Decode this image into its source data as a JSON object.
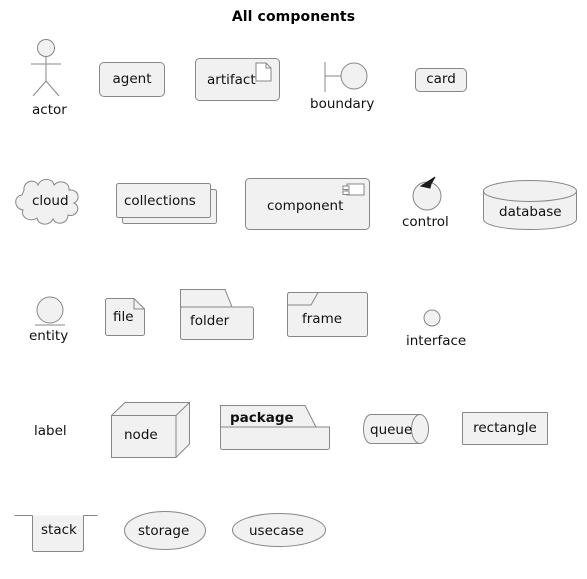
{
  "title": "All components",
  "colors": {
    "shape_fill": "#F1F1F1",
    "shape_stroke": "#878787",
    "text": "#101010",
    "background": "#FFFFFF"
  },
  "components": [
    {
      "id": "actor",
      "label": "actor",
      "icon": "actor-stick-figure-icon",
      "label_position": "below"
    },
    {
      "id": "agent",
      "label": "agent",
      "icon": "rounded-rectangle-icon",
      "label_position": "inside"
    },
    {
      "id": "artifact",
      "label": "artifact",
      "icon": "document-page-icon",
      "label_position": "inside"
    },
    {
      "id": "boundary",
      "label": "boundary",
      "icon": "boundary-bar-circle-icon",
      "label_position": "below"
    },
    {
      "id": "card",
      "label": "card",
      "icon": "rounded-rectangle-icon",
      "label_position": "inside"
    },
    {
      "id": "cloud",
      "label": "cloud",
      "icon": "cloud-icon",
      "label_position": "inside"
    },
    {
      "id": "collections",
      "label": "collections",
      "icon": "stacked-rectangles-icon",
      "label_position": "inside"
    },
    {
      "id": "component",
      "label": "component",
      "icon": "uml-component-icon",
      "label_position": "inside"
    },
    {
      "id": "control",
      "label": "control",
      "icon": "circle-arrow-icon",
      "label_position": "below"
    },
    {
      "id": "database",
      "label": "database",
      "icon": "cylinder-icon",
      "label_position": "inside"
    },
    {
      "id": "entity",
      "label": "entity",
      "icon": "circle-underline-icon",
      "label_position": "below"
    },
    {
      "id": "file",
      "label": "file",
      "icon": "folded-corner-page-icon",
      "label_position": "inside"
    },
    {
      "id": "folder",
      "label": "folder",
      "icon": "folder-icon",
      "label_position": "inside"
    },
    {
      "id": "frame",
      "label": "frame",
      "icon": "frame-icon",
      "label_position": "inside"
    },
    {
      "id": "interface",
      "label": "interface",
      "icon": "small-circle-icon",
      "label_position": "below"
    },
    {
      "id": "label",
      "label": "label",
      "icon": "plain-text-icon",
      "label_position": "inside"
    },
    {
      "id": "node",
      "label": "node",
      "icon": "three-dimensional-box-icon",
      "label_position": "inside"
    },
    {
      "id": "package",
      "label": "package",
      "icon": "package-tab-icon",
      "label_position": "inside"
    },
    {
      "id": "queue",
      "label": "queue",
      "icon": "horizontal-cylinder-icon",
      "label_position": "inside"
    },
    {
      "id": "rectangle",
      "label": "rectangle",
      "icon": "rectangle-icon",
      "label_position": "inside"
    },
    {
      "id": "stack",
      "label": "stack",
      "icon": "stack-open-top-icon",
      "label_position": "inside"
    },
    {
      "id": "storage",
      "label": "storage",
      "icon": "ellipse-icon",
      "label_position": "inside"
    },
    {
      "id": "usecase",
      "label": "usecase",
      "icon": "ellipse-icon",
      "label_position": "inside"
    }
  ]
}
